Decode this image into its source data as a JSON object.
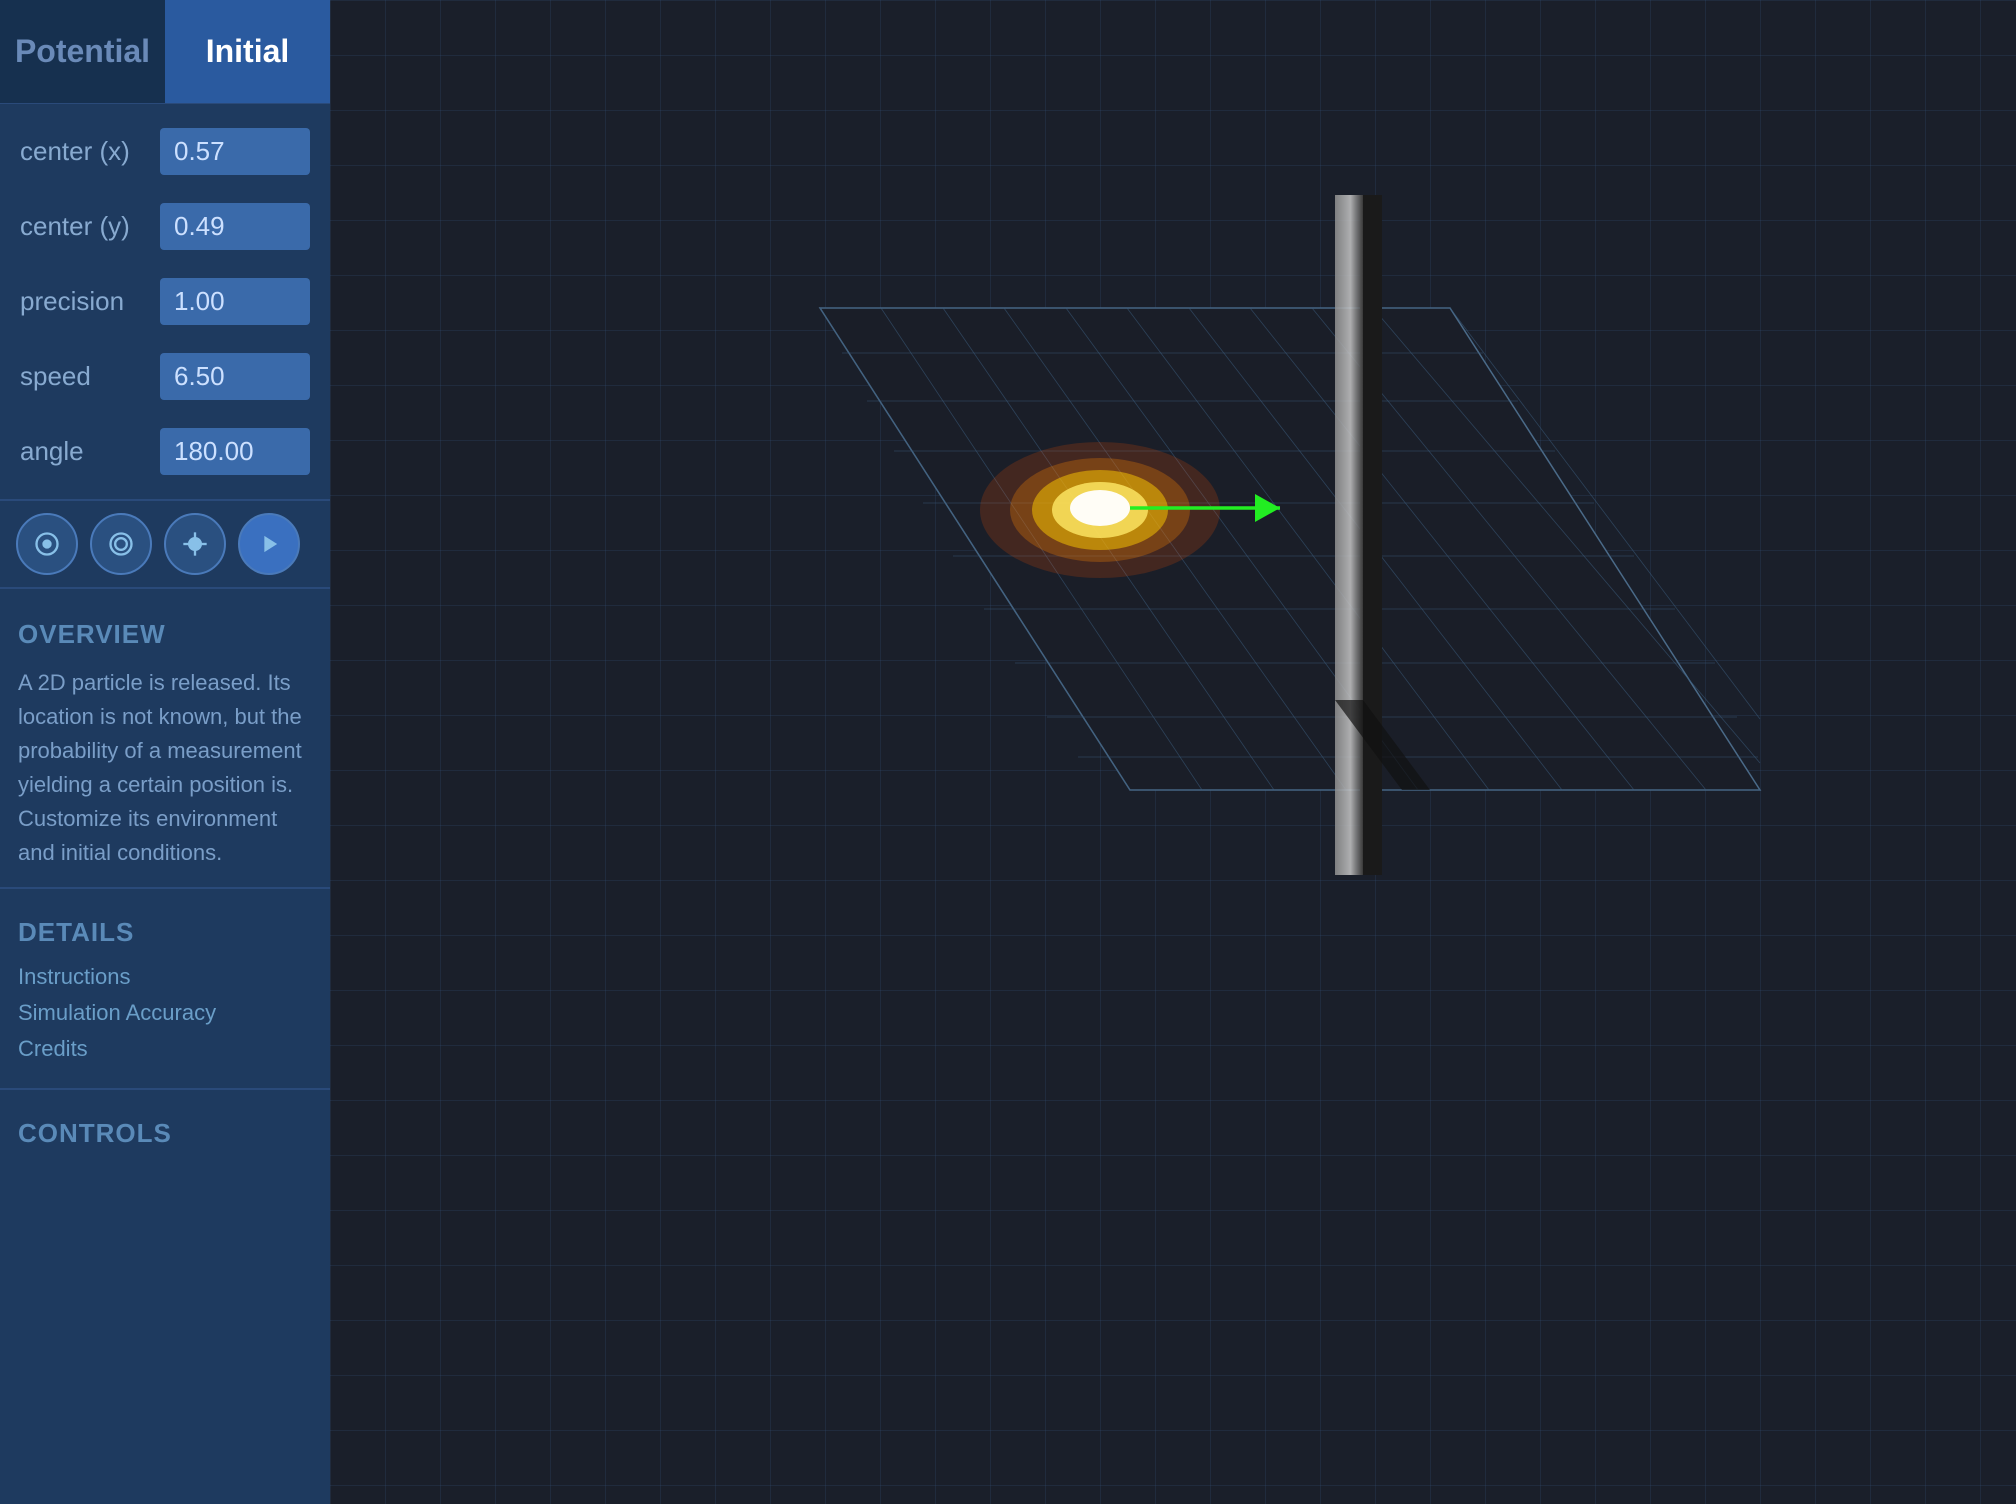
{
  "tabs": [
    {
      "label": "Potential",
      "active": false
    },
    {
      "label": "Initial",
      "active": true
    }
  ],
  "params": [
    {
      "label": "center (x)",
      "value": "0.57"
    },
    {
      "label": "center (y)",
      "value": "0.49"
    },
    {
      "label": "precision",
      "value": "1.00"
    },
    {
      "label": "speed",
      "value": "6.50"
    },
    {
      "label": "angle",
      "value": "180.00"
    }
  ],
  "controls": [
    {
      "name": "reset-icon",
      "symbol": "circle-dot"
    },
    {
      "name": "target-icon",
      "symbol": "circle-ring"
    },
    {
      "name": "edit-icon",
      "symbol": "pencil"
    },
    {
      "name": "play-icon",
      "symbol": "play"
    }
  ],
  "overview": {
    "title": "OVERVIEW",
    "text": "A 2D particle is released.  Its location is not known, but the probability of a measurement yielding a certain position is.\nCustomize its environment and initial conditions."
  },
  "details": {
    "title": "DETAILS",
    "links": [
      "Instructions",
      "Simulation Accuracy",
      "Credits"
    ]
  },
  "controls_section": {
    "title": "CONTROLS"
  },
  "colors": {
    "sidebar_bg": "#1e3a5f",
    "tab_active_bg": "#2a5a9f",
    "tab_inactive_bg": "#16304f",
    "param_value_bg": "#3a6aaa",
    "accent_blue": "#2a5a9f",
    "viewport_bg": "#1a1f2a"
  }
}
